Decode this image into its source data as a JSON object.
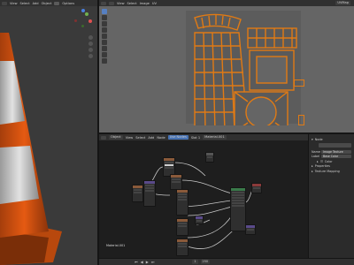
{
  "viewport3d": {
    "menu": [
      "View",
      "Select",
      "Add",
      "Object"
    ],
    "options_label": "Options",
    "bg": "#3a3a3a"
  },
  "uv_editor": {
    "menu": [
      "View",
      "Select",
      "Image",
      "UV"
    ],
    "image_label": "UVMap",
    "bg": "#656565",
    "island_color": "#e07a14"
  },
  "node_editor": {
    "menu": [
      "Object",
      "View",
      "Select",
      "Add",
      "Node",
      "Use Nodes",
      "Slot 1"
    ],
    "material_field": "Material.001",
    "corner_label": "Material.001",
    "bg": "#1e1e1e"
  },
  "sidebar": {
    "section_node": "Node",
    "name_label": "Name",
    "name_value": "Image Texture",
    "label_label": "Label",
    "label_value": "Base Color",
    "section_color": "Color",
    "section_properties": "Properties",
    "section_texture_mapping": "Texture Mapping",
    "tabs": [
      "Node",
      "Tool",
      "View",
      "Options"
    ]
  },
  "timeline": {
    "frame_label": "1",
    "end_label": "250"
  },
  "colors": {
    "cone_orange": "#e55a12",
    "cone_white": "#d8d8d8",
    "gizmo_x": "#e05050",
    "gizmo_y": "#70b050",
    "gizmo_z": "#4a7fe0"
  }
}
